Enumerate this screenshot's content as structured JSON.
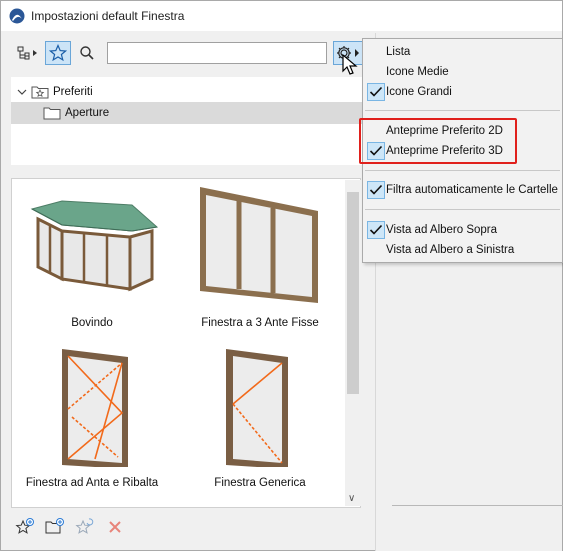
{
  "window": {
    "title": "Impostazioni default Finestra"
  },
  "toolbar": {
    "search": {
      "value": "",
      "placeholder": ""
    }
  },
  "tree": {
    "items": [
      {
        "label": "Preferiti"
      },
      {
        "label": "Aperture"
      }
    ]
  },
  "grid": {
    "items": [
      {
        "label": "Bovindo"
      },
      {
        "label": "Finestra a 3 Ante Fisse"
      },
      {
        "label": "Finestra ad Anta e Ribalta"
      },
      {
        "label": "Finestra Generica"
      }
    ]
  },
  "menu": {
    "items": [
      {
        "label": "Lista",
        "checked": false
      },
      {
        "label": "Icone Medie",
        "checked": false
      },
      {
        "label": "Icone Grandi",
        "checked": true
      },
      {
        "label": "Anteprime Preferito 2D",
        "checked": false
      },
      {
        "label": "Anteprime Preferito 3D",
        "checked": true
      },
      {
        "label": "Filtra automaticamente le Cartelle",
        "checked": true
      },
      {
        "label": "Vista ad Albero Sopra",
        "checked": true
      },
      {
        "label": "Vista ad Albero a Sinistra",
        "checked": false
      }
    ]
  },
  "colors": {
    "accent": "#cce4f7",
    "highlight": "#e0201c",
    "frame": "#8b7355"
  }
}
